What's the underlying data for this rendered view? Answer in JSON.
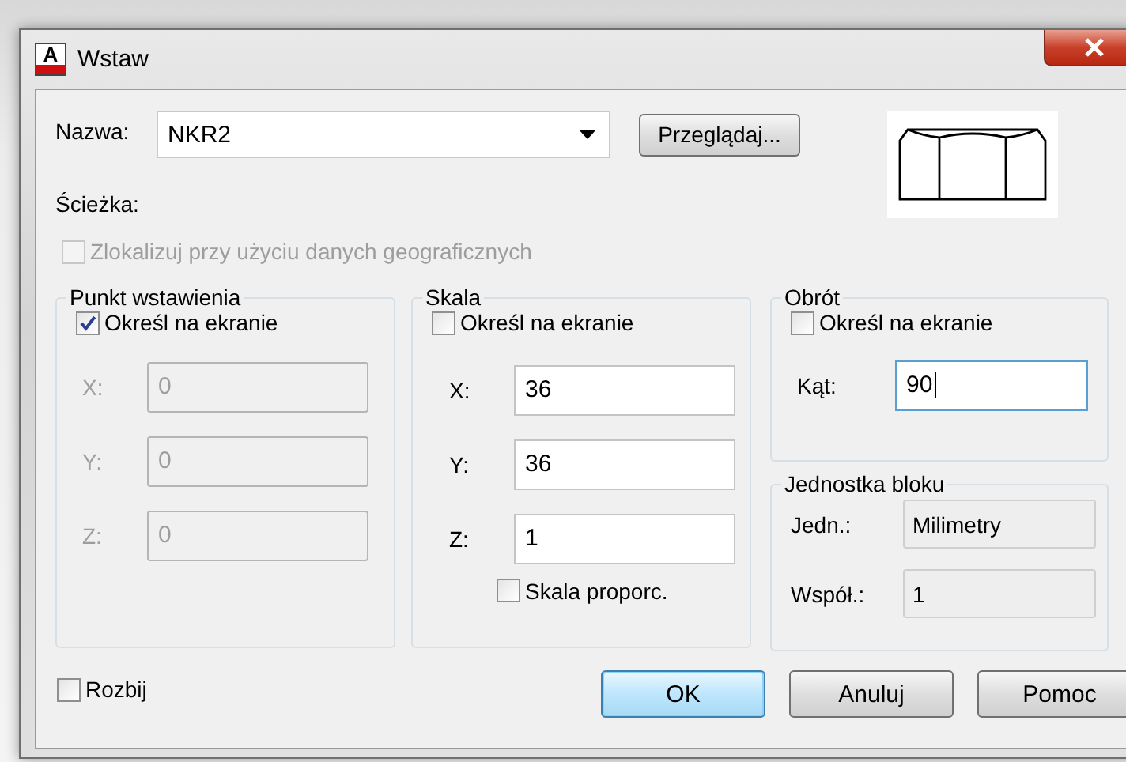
{
  "window": {
    "title": "Wstaw",
    "icon_letter": "A"
  },
  "name": {
    "label": "Nazwa:",
    "value": "NKR2"
  },
  "browse_button": "Przeglądaj...",
  "path": {
    "label": "Ścieżka:"
  },
  "geo_checkbox": {
    "label": "Zlokalizuj przy użyciu danych geograficznych",
    "checked": false,
    "disabled": true
  },
  "groups": [
    {
      "title": "Punkt wstawienia",
      "checkbox": {
        "label": "Określ na ekranie",
        "checked": true
      },
      "fields": [
        {
          "label": "X:",
          "value": "0",
          "disabled": true,
          "focused": false
        },
        {
          "label": "Y:",
          "value": "0",
          "disabled": true,
          "focused": false
        },
        {
          "label": "Z:",
          "value": "0",
          "disabled": true,
          "focused": false
        }
      ]
    },
    {
      "title": "Skala",
      "checkbox": {
        "label": "Określ na ekranie",
        "checked": false
      },
      "fields": [
        {
          "label": "X:",
          "value": "36",
          "disabled": false,
          "focused": false
        },
        {
          "label": "Y:",
          "value": "36",
          "disabled": false,
          "focused": false
        },
        {
          "label": "Z:",
          "value": "1",
          "disabled": false,
          "focused": false
        }
      ],
      "extra_checkbox": {
        "label": "Skala proporc.",
        "checked": false
      }
    },
    {
      "title": "Obrót",
      "checkbox": {
        "label": "Określ na ekranie",
        "checked": false
      },
      "fields": [
        {
          "label": "Kąt:",
          "value": "90",
          "disabled": false,
          "focused": true
        }
      ]
    }
  ],
  "unit_group": {
    "title": "Jednostka bloku",
    "fields": [
      {
        "label": "Jedn.:",
        "value": "Milimetry"
      },
      {
        "label": "Współ.:",
        "value": "1"
      }
    ]
  },
  "explode_checkbox": {
    "label": "Rozbij",
    "checked": false
  },
  "buttons": [
    {
      "label": "OK",
      "default": true
    },
    {
      "label": "Anuluj",
      "default": false
    },
    {
      "label": "Pomoc",
      "default": false
    }
  ]
}
